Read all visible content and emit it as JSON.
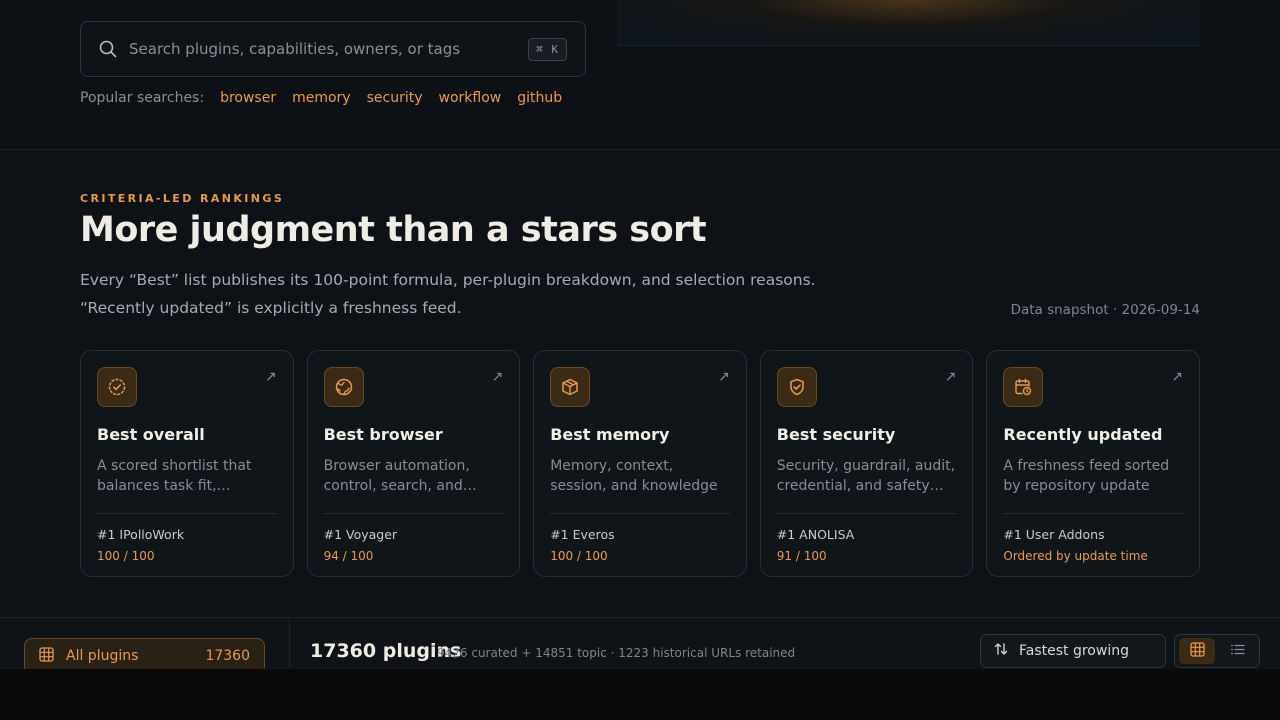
{
  "search": {
    "placeholder": "Search plugins, capabilities, owners, or tags",
    "shortcut": "⌘ K",
    "popular_label": "Popular searches:",
    "popular_tags": [
      "browser",
      "memory",
      "security",
      "workflow",
      "github"
    ]
  },
  "rankings": {
    "eyebrow": "CRITERIA-LED RANKINGS",
    "heading": "More judgment than a stars sort",
    "desc_line1": "Every “Best” list publishes its 100-point formula, per-plugin breakdown, and selection reasons.",
    "desc_line2": "“Recently updated” is explicitly a freshness feed.",
    "snapshot": "Data snapshot · 2026-09-14",
    "cards": [
      {
        "icon": "badge-check-icon",
        "title": "Best overall",
        "desc": "A scored shortlist that balances task fit,…",
        "top": "#1 IPolloWork",
        "score": "100 / 100"
      },
      {
        "icon": "globe-icon",
        "title": "Best browser",
        "desc": "Browser automation, control, search, and…",
        "top": "#1 Voyager",
        "score": "94 / 100"
      },
      {
        "icon": "box-icon",
        "title": "Best memory",
        "desc": "Memory, context, session, and knowledge plugins…",
        "top": "#1 Everos",
        "score": "100 / 100"
      },
      {
        "icon": "shield-check-icon",
        "title": "Best security",
        "desc": "Security, guardrail, audit, credential, and safety…",
        "top": "#1 ANOLISA",
        "score": "91 / 100"
      },
      {
        "icon": "calendar-clock-icon",
        "title": "Recently updated",
        "desc": "A freshness feed sorted by repository update time,…",
        "top": "#1 User Addons",
        "score": "Ordered by update time"
      }
    ]
  },
  "listing": {
    "all_plugins_label": "All plugins",
    "all_plugins_count": "17360",
    "count_title": "17360 plugins",
    "count_sub": "9426 curated + 14851 topic · 1223 historical URLs retained",
    "sort_label": "Fastest growing"
  },
  "colors": {
    "accent": "#e89a4c",
    "background": "#0b0e11"
  }
}
